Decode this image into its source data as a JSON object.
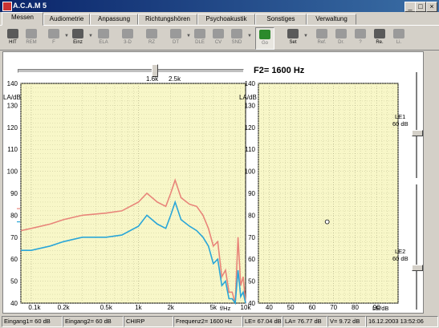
{
  "window": {
    "title": "A.C.A.M 5",
    "minimize": "_",
    "maximize": "□",
    "close": "×"
  },
  "tabs": [
    "Messen",
    "Audiometrie",
    "Anpassung",
    "Richtungshören",
    "Psychoakustik",
    "Sonstiges",
    "Verwaltung"
  ],
  "toolbar": [
    "HIT",
    "REM",
    "F",
    "Einz",
    "ELA",
    "3-D",
    "RZ",
    "DT",
    "DLE",
    "CV",
    "SND",
    "Go",
    "Set",
    "Ref.",
    "Dr.",
    "?",
    "Re.",
    "Li."
  ],
  "slider": {
    "label_left": "1.6k",
    "label_right": "2.5k",
    "readout": "F2= 1600 Hz"
  },
  "left_chart": {
    "y_unit": "LA/dB",
    "y_ticks": [
      "140",
      "130",
      "120",
      "110",
      "100",
      "90",
      "80",
      "70",
      "60",
      "50",
      "40"
    ],
    "x_ticks": [
      "0.1k",
      "0.2k",
      "0.5k",
      "1k",
      "2k",
      "5k",
      "10k"
    ],
    "x_unit": "f/Hz"
  },
  "right_chart": {
    "y_unit": "LA/dB",
    "y_ticks": [
      "140",
      "130",
      "120",
      "110",
      "100",
      "90",
      "80",
      "70",
      "60",
      "50",
      "40"
    ],
    "x_ticks": [
      "40",
      "50",
      "60",
      "70",
      "80",
      "90"
    ],
    "x_unit": "LE/dB"
  },
  "le1": {
    "label": "LE1",
    "value": "60 dB"
  },
  "le2": {
    "label": "LE2",
    "value": "60 dB"
  },
  "status": [
    "Eingang1= 60 dB",
    "Eingang2= 60 dB",
    "CHIRP",
    "Frequenz2= 1600 Hz",
    "LE= 67.04 dB",
    "LA= 76.77 dB",
    "V= 9.72 dB",
    "16.12.2003 13:52:06"
  ],
  "colors": {
    "red_curve": "#e8857a",
    "blue_curve": "#2aa6d8",
    "plot_bg": "#f8f7c8",
    "grid": "#c8c89a"
  },
  "chart_data": {
    "type": "line",
    "x_scale": "log",
    "xlim": [
      80,
      10000
    ],
    "ylim": [
      40,
      140
    ],
    "xlabel": "f/Hz",
    "ylabel": "LA/dB",
    "series": [
      {
        "x": [
          80,
          100,
          150,
          200,
          300,
          500,
          700,
          1000,
          1200,
          1500,
          1800,
          2000,
          2200,
          2500,
          3000,
          3500,
          4000,
          4500,
          5000,
          5500,
          6000,
          6500,
          7000,
          7500,
          8000,
          8500,
          9000,
          9500,
          10000
        ],
        "y": [
          73,
          74,
          76,
          78,
          80,
          81,
          82,
          86,
          90,
          86,
          84,
          90,
          96,
          88,
          85,
          84,
          80,
          74,
          66,
          68,
          52,
          55,
          45,
          45,
          40,
          70,
          48,
          52,
          40
        ]
      },
      {
        "x": [
          80,
          100,
          150,
          200,
          300,
          500,
          700,
          1000,
          1200,
          1500,
          1800,
          2000,
          2200,
          2500,
          3000,
          3500,
          4000,
          4500,
          5000,
          5500,
          6000,
          6500,
          7000,
          7500,
          8000,
          8500,
          9000,
          9500,
          10000
        ],
        "y": [
          64,
          64,
          66,
          68,
          70,
          70,
          71,
          75,
          80,
          76,
          74,
          80,
          86,
          78,
          75,
          73,
          70,
          66,
          58,
          60,
          48,
          50,
          42,
          42,
          40,
          55,
          43,
          45,
          40
        ]
      }
    ],
    "points": [
      {
        "x": 67,
        "y": 77
      }
    ]
  }
}
